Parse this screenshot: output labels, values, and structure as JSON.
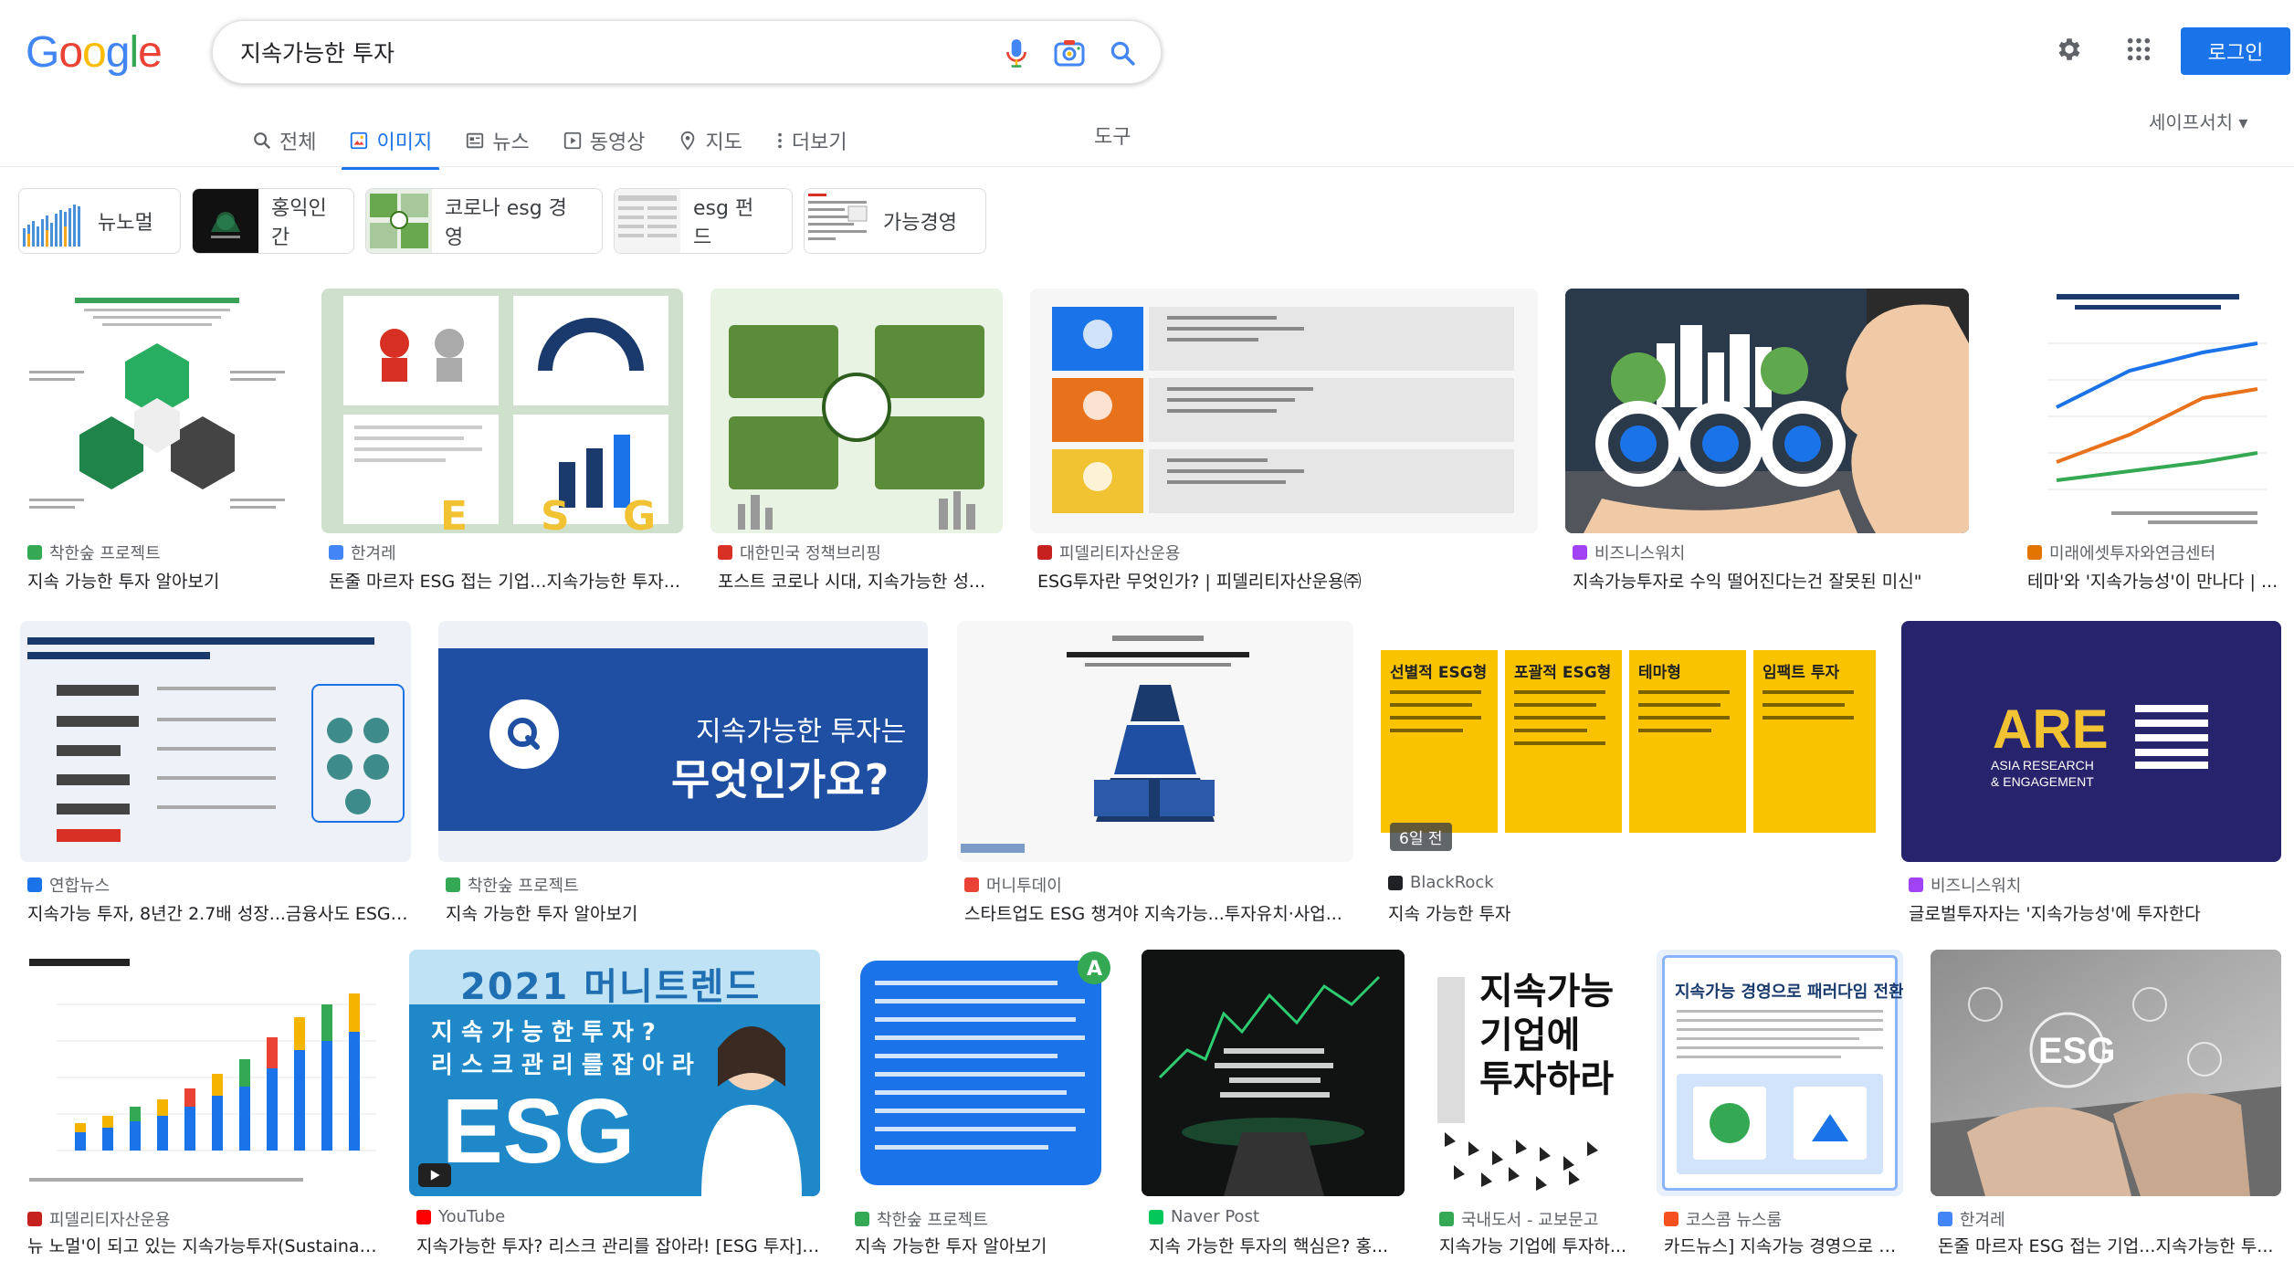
{
  "header": {
    "query": "지속가능한 투자",
    "login_label": "로그인",
    "logo_letters": [
      "G",
      "o",
      "o",
      "g",
      "l",
      "e"
    ],
    "logo_colors": [
      "#4285f4",
      "#ea4335",
      "#fbbc05",
      "#4285f4",
      "#34a853",
      "#ea4335"
    ]
  },
  "tabs": {
    "all": "전체",
    "images": "이미지",
    "news": "뉴스",
    "videos": "동영상",
    "maps": "지도",
    "more": "더보기",
    "tools": "도구",
    "safesearch": "세이프서치 ▾"
  },
  "chips": [
    "뉴노멀",
    "홍익인간",
    "코로나 esg 경영",
    "esg 펀드",
    "가능경영"
  ],
  "results": [
    {
      "source": "착한숲 프로젝트",
      "title": "지속 가능한 투자 알아보기",
      "fav": "#34a853"
    },
    {
      "source": "한겨레",
      "title": "돈줄 마르자 ESG 접는 기업...지속가능한 투자...",
      "fav": "#4285f4"
    },
    {
      "source": "대한민국 정책브리핑",
      "title": "포스트 코로나 시대, 지속가능한 성...",
      "fav": "#d93025"
    },
    {
      "source": "피델리티자산운용",
      "title": "ESG투자란 무엇인가? | 피델리티자산운용㈜",
      "fav": "#c5221f"
    },
    {
      "source": "비즈니스워치",
      "title": "지속가능투자로 수익 떨어진다는건 잘못된 미신\"",
      "fav": "#a142f4"
    },
    {
      "source": "미래에셋투자와연금센터",
      "title": "테마'와 '지속가능성'이 만나다 | ...",
      "fav": "#e37400"
    },
    {
      "source": "연합뉴스",
      "title": "지속가능 투자, 8년간 2.7배 성장...금융사도 ESG ...",
      "fav": "#1a73e8"
    },
    {
      "source": "착한숲 프로젝트",
      "title": "지속 가능한 투자 알아보기",
      "fav": "#34a853"
    },
    {
      "source": "머니투데이",
      "title": "스타트업도 ESG 챙겨야 지속가능...투자유치·사업...",
      "fav": "#ea4335"
    },
    {
      "source": "BlackRock",
      "title": "지속 가능한 투자",
      "fav": "#202124",
      "badge": "6일 전"
    },
    {
      "source": "비즈니스워치",
      "title": "글로벌투자자는 '지속가능성'에 투자한다",
      "fav": "#a142f4"
    },
    {
      "source": "피델리티자산운용",
      "title": "뉴 노멀'이 되고 있는 지속가능투자(Sustainab...",
      "fav": "#c5221f"
    },
    {
      "source": "YouTube",
      "title": "지속가능한 투자? 리스크 관리를 잡아라! [ESG 투자] ...",
      "fav": "#ff0000"
    },
    {
      "source": "착한숲 프로젝트",
      "title": "지속 가능한 투자 알아보기",
      "fav": "#34a853"
    },
    {
      "source": "Naver Post",
      "title": "지속 가능한 투자의 핵심은? 홍...",
      "fav": "#03c75a"
    },
    {
      "source": "국내도서 - 교보문고",
      "title": "지속가능 기업에 투자하...",
      "fav": "#34a853"
    },
    {
      "source": "코스콤 뉴스룸",
      "title": "카드뉴스] 지속가능 경영으로 패러다임 전환",
      "fav": "#f4511e"
    },
    {
      "source": "한겨레",
      "title": "돈줄 마르자 ESG 접는 기업...지속가능한 투...",
      "fav": "#4285f4"
    }
  ],
  "art": {
    "card2_title": "지속가능한 투자는",
    "card2_sub": "무엇인가요?",
    "are_title": "ARE",
    "are_sub1": "ASIA RESEARCH",
    "are_sub2": "& ENGAGEMENT",
    "money_trend": "2021 머니트렌드",
    "money_q": "지 속 가 능 한 투 자 ?",
    "money_r": "리 스 크 관 리 를 잡 아 라",
    "esg": "ESG",
    "book_title1": "지속가능",
    "book_title2": "기업에",
    "book_title3": "투자하라",
    "koscom_title": "지속가능 경영으로 패러다임 전환",
    "blackrock_h": [
      "선별적 ESG형",
      "포괄적 ESG형",
      "테마형",
      "임팩트 투자"
    ],
    "esg_letters": [
      "E",
      "S",
      "G"
    ]
  }
}
